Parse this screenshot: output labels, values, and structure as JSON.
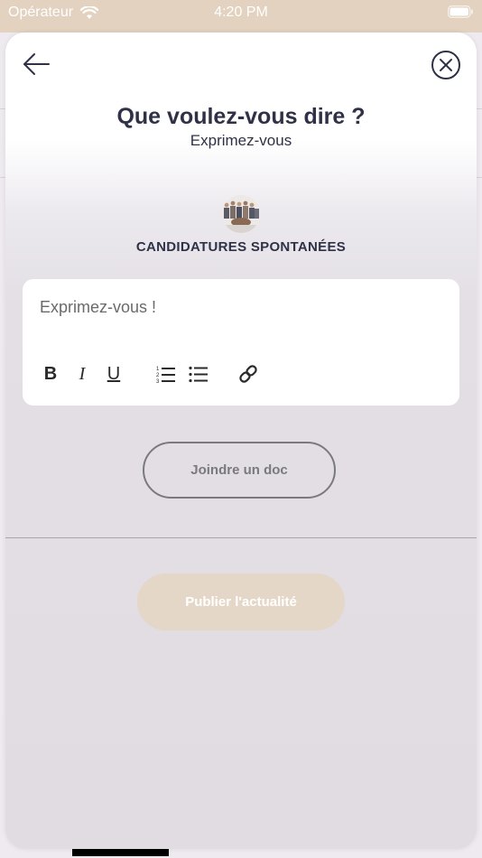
{
  "status_bar": {
    "carrier": "Opérateur",
    "time": "4:20 PM"
  },
  "header": {
    "title": "Que voulez-vous dire ?",
    "subtitle": "Exprimez-vous"
  },
  "group": {
    "name": "CANDIDATURES SPONTANÉES"
  },
  "editor": {
    "placeholder": "Exprimez-vous !",
    "toolbar": {
      "bold": "B",
      "italic": "I",
      "underline": "U"
    }
  },
  "actions": {
    "attach_label": "Joindre un doc",
    "publish_label": "Publier l'actualité"
  },
  "colors": {
    "accent": "#e2d2bf",
    "title_text": "#2f3147",
    "publish_button": "#e5d7c7",
    "attach_border": "#7a7a7d"
  },
  "icons": [
    "wifi-icon",
    "battery-icon",
    "back-arrow-icon",
    "close-circle-icon",
    "ordered-list-icon",
    "bullet-list-icon",
    "link-icon"
  ]
}
